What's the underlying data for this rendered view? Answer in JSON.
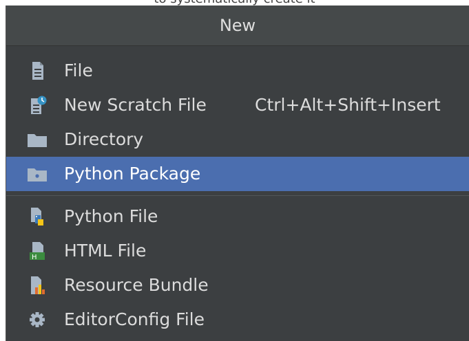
{
  "top_caption": "to systematically create it",
  "popup": {
    "title": "New",
    "group1": [
      {
        "label": "File",
        "shortcut": "",
        "icon": "file-icon"
      },
      {
        "label": "New Scratch File",
        "shortcut": "Ctrl+Alt+Shift+Insert",
        "icon": "scratch-file-icon"
      },
      {
        "label": "Directory",
        "shortcut": "",
        "icon": "folder-icon"
      },
      {
        "label": "Python Package",
        "shortcut": "",
        "icon": "package-folder-icon",
        "selected": true
      }
    ],
    "group2": [
      {
        "label": "Python File",
        "icon": "python-file-icon"
      },
      {
        "label": "HTML File",
        "icon": "html-file-icon"
      },
      {
        "label": "Resource Bundle",
        "icon": "resource-bundle-icon"
      },
      {
        "label": "EditorConfig File",
        "icon": "gear-icon"
      }
    ]
  },
  "colors": {
    "background": "#3c3f41",
    "header": "#45494a",
    "selection": "#4b6eaf",
    "text": "#dcdcdc"
  }
}
